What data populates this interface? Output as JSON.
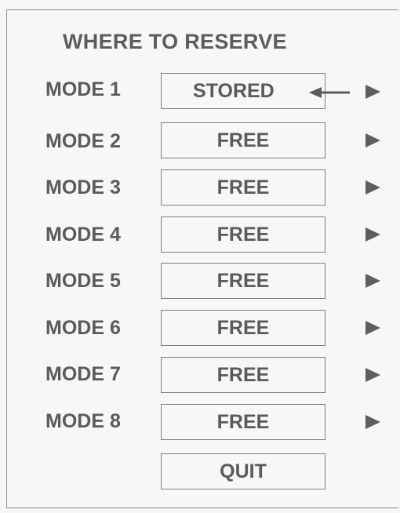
{
  "menu": {
    "title": "WHERE TO RESERVE",
    "modes": [
      {
        "label": "MODE 1",
        "slot": "STORED"
      },
      {
        "label": "MODE 2",
        "slot": "FREE"
      },
      {
        "label": "MODE 3",
        "slot": "FREE"
      },
      {
        "label": "MODE 4",
        "slot": "FREE"
      },
      {
        "label": "MODE 5",
        "slot": "FREE"
      },
      {
        "label": "MODE 6",
        "slot": "FREE"
      },
      {
        "label": "MODE 7",
        "slot": "FREE"
      },
      {
        "label": "MODE 8",
        "slot": "FREE"
      }
    ],
    "quit_label": "QUIT",
    "selection_indicator": "left-arrow-icon",
    "row_marker": "play-triangle-icon"
  }
}
